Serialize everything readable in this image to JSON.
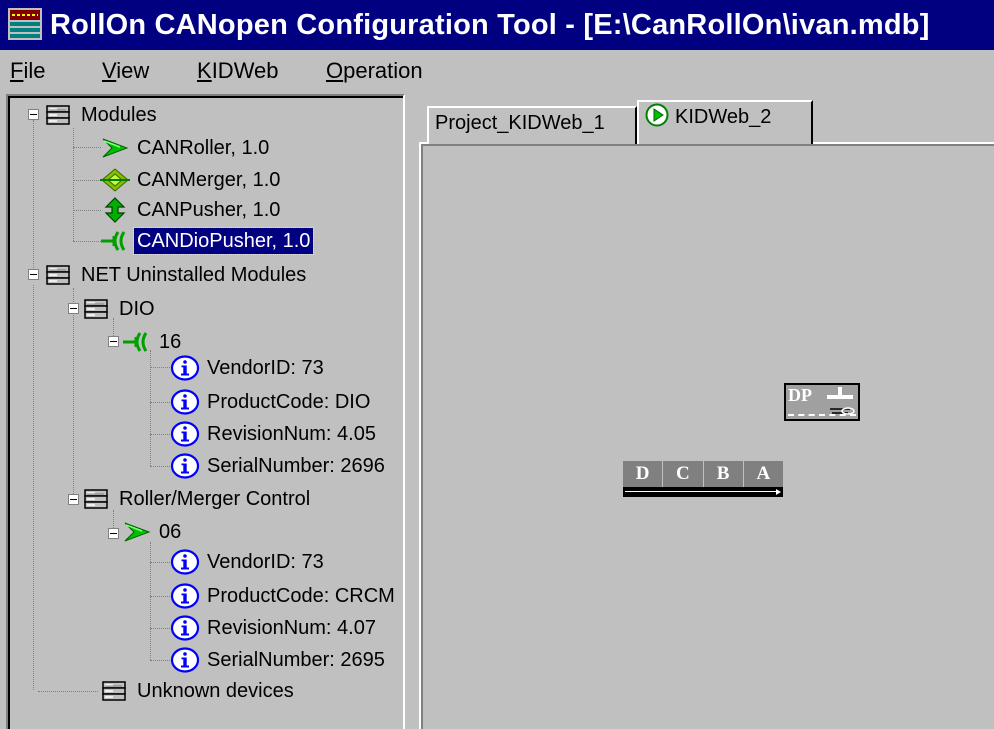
{
  "window": {
    "title": "RollOn CANopen Configuration Tool - [E:\\CanRollOn\\ivan.mdb]"
  },
  "menu": [
    {
      "underline": "F",
      "rest": "ile"
    },
    {
      "underline": "V",
      "rest": "iew"
    },
    {
      "underline": "K",
      "rest": "IDWeb"
    },
    {
      "underline": "O",
      "rest": "peration"
    }
  ],
  "tree": {
    "modules": "Modules",
    "canroller": "CANRoller, 1.0",
    "canmerger": "CANMerger, 1.0",
    "canpusher": "CANPusher, 1.0",
    "candiopusher": "CANDioPusher, 1.0",
    "net_uninstalled": "NET Uninstalled Modules",
    "dio": "DIO",
    "dio_node": "16",
    "dio_vendor": "VendorID: 73",
    "dio_product": "ProductCode: DIO",
    "dio_revision": "RevisionNum: 4.05",
    "dio_serial": "SerialNumber: 2696",
    "roller_merger": "Roller/Merger Control",
    "rm_node": "06",
    "rm_vendor": "VendorID: 73",
    "rm_product": "ProductCode: CRCM",
    "rm_revision": "RevisionNum: 4.07",
    "rm_serial": "SerialNumber: 2695",
    "unknown": "Unknown devices"
  },
  "tabs": {
    "project": "Project_KIDWeb_1",
    "kidweb2": "KIDWeb_2"
  },
  "canvas": {
    "dp_block": "DP",
    "dcba_block": [
      "D",
      "C",
      "B",
      "A"
    ]
  },
  "colors": {
    "title_bg": "#000080",
    "face": "#c0c0c0",
    "info_blue": "#0000ff",
    "module_green": "#00a000"
  }
}
